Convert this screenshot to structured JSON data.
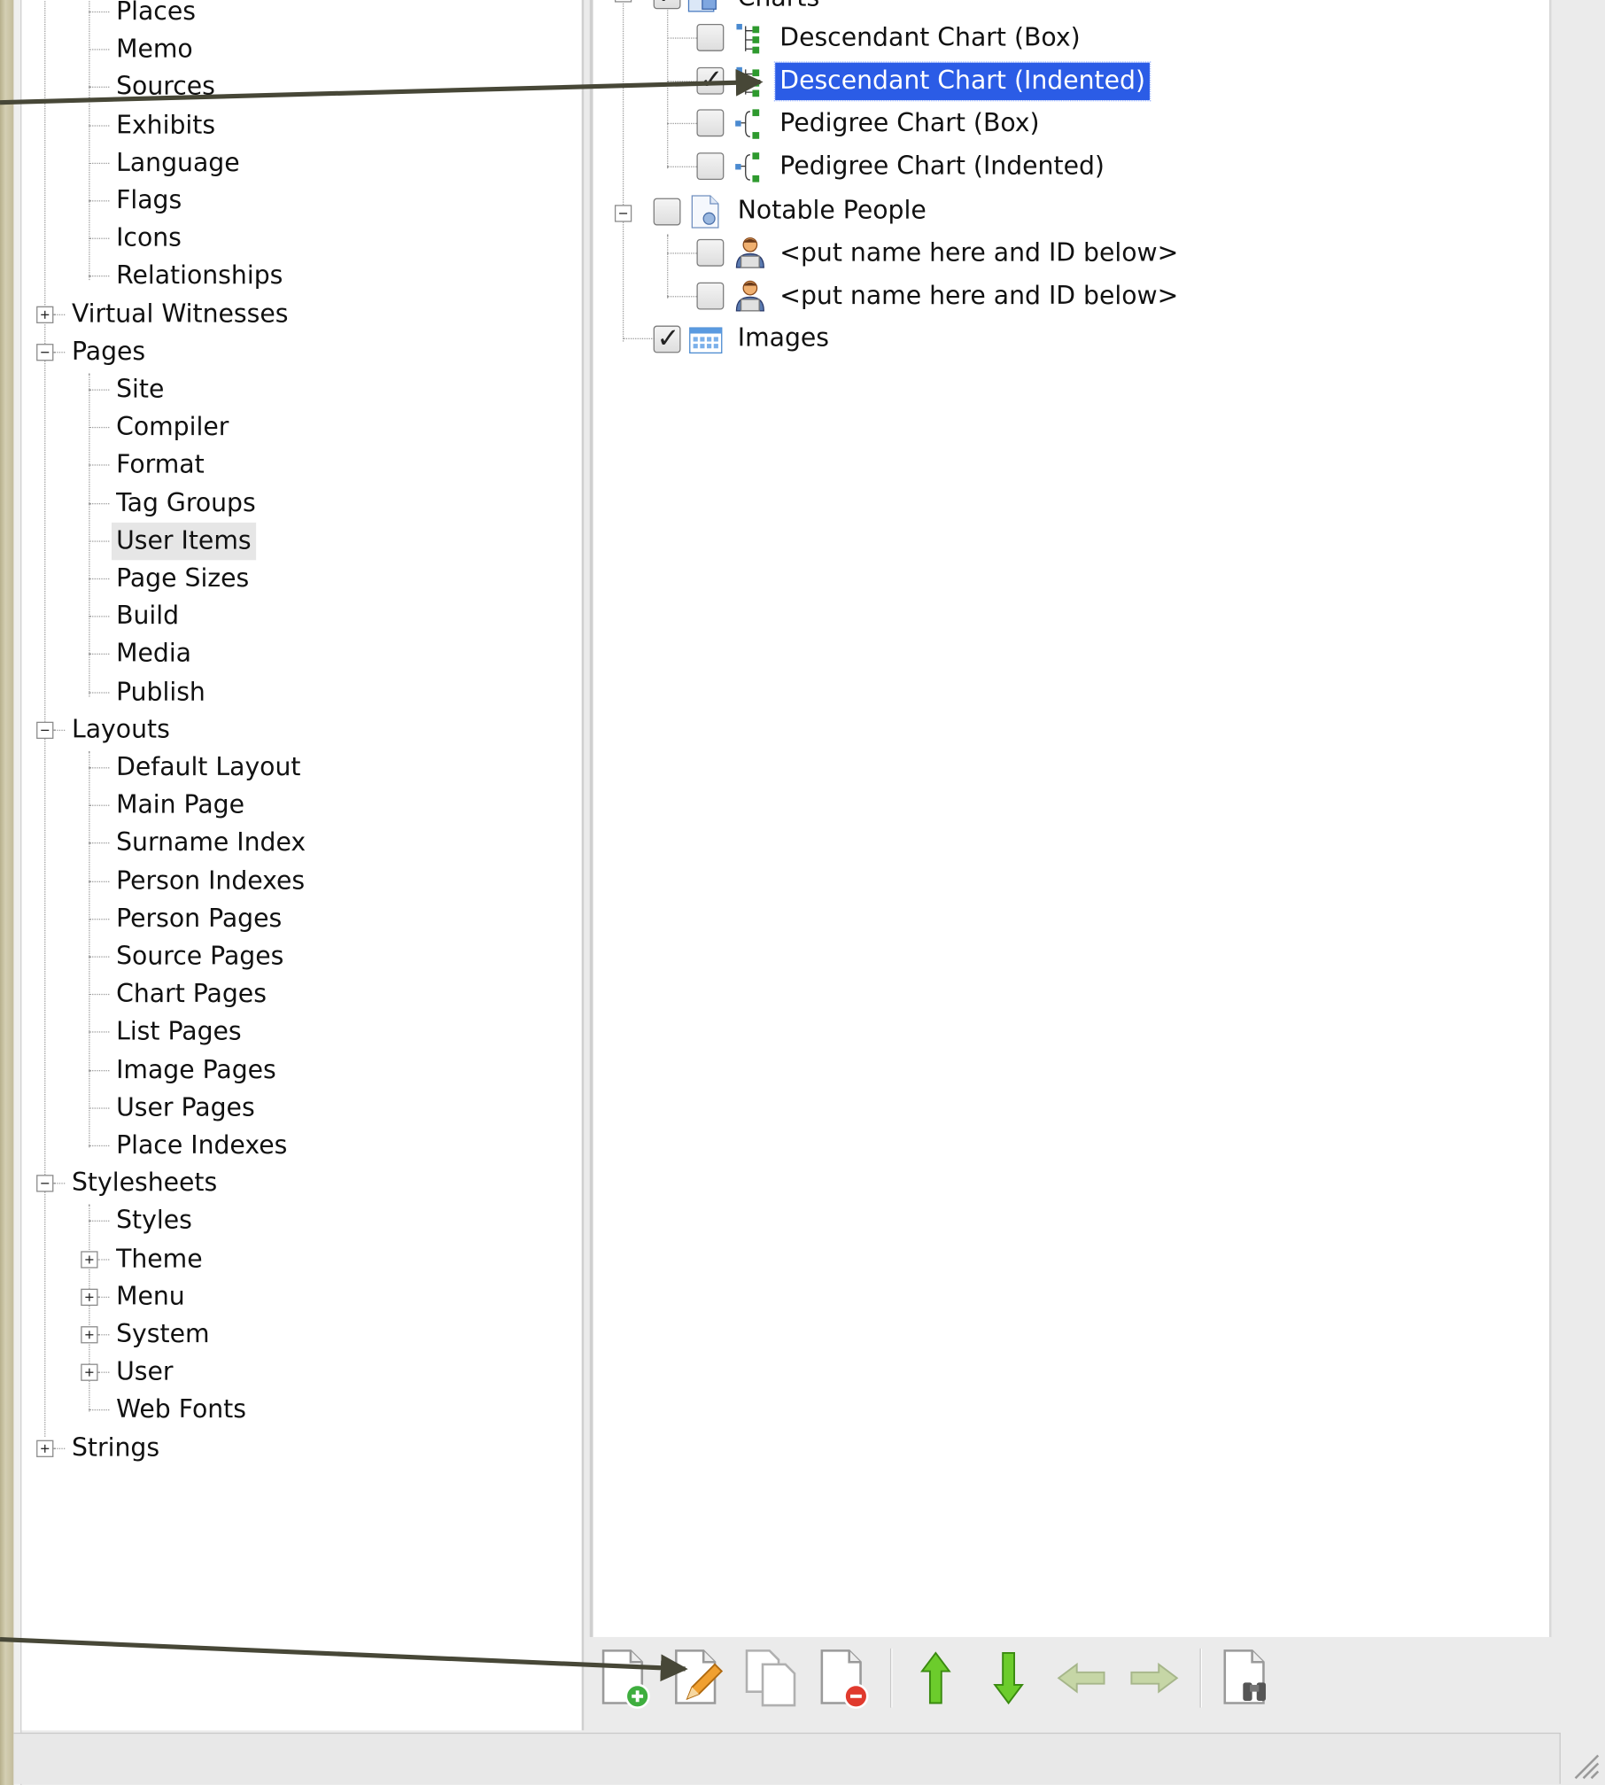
{
  "left_tree": {
    "nodes": [
      {
        "label": "Places",
        "level": 1
      },
      {
        "label": "Memo",
        "level": 1
      },
      {
        "label": "Sources",
        "level": 1
      },
      {
        "label": "Exhibits",
        "level": 1
      },
      {
        "label": "Language",
        "level": 1
      },
      {
        "label": "Flags",
        "level": 1
      },
      {
        "label": "Icons",
        "level": 1
      },
      {
        "label": "Relationships",
        "level": 1
      },
      {
        "label": "Virtual Witnesses",
        "level": 0,
        "expander": "plus"
      },
      {
        "label": "Pages",
        "level": 0,
        "expander": "minus"
      },
      {
        "label": "Site",
        "level": 1
      },
      {
        "label": "Compiler",
        "level": 1
      },
      {
        "label": "Format",
        "level": 1
      },
      {
        "label": "Tag Groups",
        "level": 1
      },
      {
        "label": "User Items",
        "level": 1,
        "selected": true
      },
      {
        "label": "Page Sizes",
        "level": 1
      },
      {
        "label": "Build",
        "level": 1
      },
      {
        "label": "Media",
        "level": 1
      },
      {
        "label": "Publish",
        "level": 1
      },
      {
        "label": "Layouts",
        "level": 0,
        "expander": "minus"
      },
      {
        "label": "Default Layout",
        "level": 1
      },
      {
        "label": "Main Page",
        "level": 1
      },
      {
        "label": "Surname Index",
        "level": 1
      },
      {
        "label": "Person Indexes",
        "level": 1
      },
      {
        "label": "Person Pages",
        "level": 1
      },
      {
        "label": "Source Pages",
        "level": 1
      },
      {
        "label": "Chart Pages",
        "level": 1
      },
      {
        "label": "List Pages",
        "level": 1
      },
      {
        "label": "Image Pages",
        "level": 1
      },
      {
        "label": "User Pages",
        "level": 1
      },
      {
        "label": "Place Indexes",
        "level": 1
      },
      {
        "label": "Stylesheets",
        "level": 0,
        "expander": "minus"
      },
      {
        "label": "Styles",
        "level": 1
      },
      {
        "label": "Theme",
        "level": 1,
        "expander": "plus"
      },
      {
        "label": "Menu",
        "level": 1,
        "expander": "plus"
      },
      {
        "label": "System",
        "level": 1,
        "expander": "plus"
      },
      {
        "label": "User",
        "level": 1,
        "expander": "plus"
      },
      {
        "label": "Web Fonts",
        "level": 1
      },
      {
        "label": "Strings",
        "level": 0,
        "expander": "plus"
      }
    ]
  },
  "right_tree": {
    "charts_group_label": "Charts",
    "items": [
      {
        "label": "Descendant Chart (Box)",
        "checked": false,
        "icon": "descendant-chart-icon"
      },
      {
        "label": "Descendant Chart (Indented)",
        "checked": true,
        "icon": "descendant-chart-icon",
        "selected": true
      },
      {
        "label": "Pedigree Chart (Box)",
        "checked": false,
        "icon": "pedigree-chart-icon"
      },
      {
        "label": "Pedigree Chart (Indented)",
        "checked": false,
        "icon": "pedigree-chart-icon"
      }
    ],
    "notable_label": "Notable People",
    "notable_checked": false,
    "people": [
      {
        "label": "<put name here and ID below>",
        "checked": false
      },
      {
        "label": "<put name here and ID below>",
        "checked": false
      }
    ],
    "images_label": "Images",
    "images_checked": true,
    "selection_color": "#2b5ce6"
  },
  "toolbar": {
    "buttons": [
      {
        "name": "add-item-button",
        "icon": "new-document-icon",
        "enabled": true
      },
      {
        "name": "edit-item-button",
        "icon": "edit-document-icon",
        "enabled": true
      },
      {
        "name": "copy-item-button",
        "icon": "copy-document-icon",
        "enabled": false
      },
      {
        "name": "delete-item-button",
        "icon": "delete-document-icon",
        "enabled": true
      },
      {
        "name": "move-up-button",
        "icon": "arrow-up-icon",
        "enabled": true
      },
      {
        "name": "move-down-button",
        "icon": "arrow-down-icon",
        "enabled": true
      },
      {
        "name": "move-left-button",
        "icon": "arrow-left-icon",
        "enabled": false
      },
      {
        "name": "move-right-button",
        "icon": "arrow-right-icon",
        "enabled": false
      },
      {
        "name": "find-button",
        "icon": "binoculars-icon",
        "enabled": true
      }
    ]
  }
}
